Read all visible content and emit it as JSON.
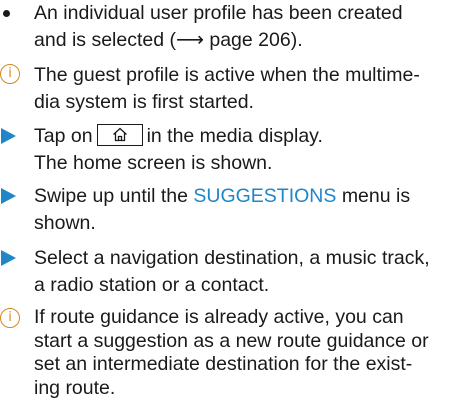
{
  "items": [
    {
      "type": "bullet",
      "marker": "bullet-dot",
      "lines": [
        "An individual user profile has been created",
        "and is selected (⟶ page 206)."
      ]
    },
    {
      "type": "info",
      "marker": "info-icon",
      "icon_glyph": "i",
      "lines": [
        "The guest profile is active when the multime-",
        "dia system is first started."
      ]
    },
    {
      "type": "step",
      "marker": "step-arrow",
      "line1_before": "Tap on",
      "line1_icon": "home-icon",
      "line1_after": "in the media display.",
      "line2": "The home screen is shown."
    },
    {
      "type": "step",
      "marker": "step-arrow",
      "line1_before": "Swipe up until the",
      "line1_link": "SUGGESTIONS",
      "line1_after": "menu is",
      "line2": "shown."
    },
    {
      "type": "step",
      "marker": "step-arrow",
      "lines": [
        "Select a navigation destination, a music track,",
        "a radio station or a contact."
      ]
    },
    {
      "type": "info",
      "marker": "info-icon",
      "icon_glyph": "i",
      "lines": [
        "If route guidance is already active, you can",
        "start a suggestion as a new route guidance or",
        "set an intermediate destination for the exist-",
        "ing route."
      ]
    }
  ],
  "colors": {
    "text": "#1a1a1a",
    "accent_blue": "#1f86c8",
    "info_orange": "#d4891f"
  }
}
